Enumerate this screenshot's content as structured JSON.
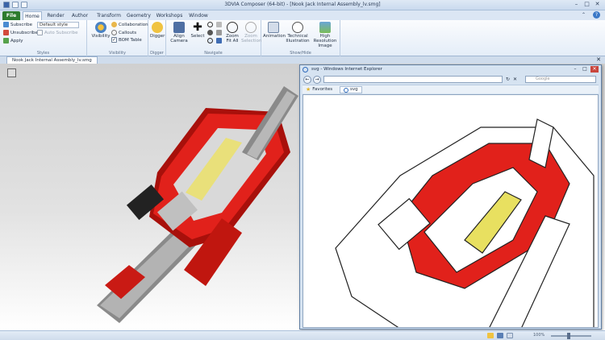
{
  "window": {
    "title": "3DVIA Composer (64-bit) - [Nook Jack Internal Assembly_lv.smg]"
  },
  "tabs": [
    "File",
    "Home",
    "Render",
    "Author",
    "Transform",
    "Geometry",
    "Workshops",
    "Window"
  ],
  "ribbon": {
    "styles": {
      "subscribe": "Subscribe",
      "unsubscribe": "Unsubscribe",
      "apply": "Apply",
      "style_value": "Default style",
      "auto_subscribe": "Auto Subscribe",
      "label": "Styles"
    },
    "visibility": {
      "visibility": "Visibility",
      "collaboration": "Collaboration",
      "callouts": "Callouts",
      "bom_table": "BOM Table",
      "label": "Visibility"
    },
    "digger": {
      "digger": "Digger",
      "label": "Digger"
    },
    "navigate": {
      "align_camera": "Align Camera",
      "select": "Select",
      "zoom_fit_all": "Zoom Fit All",
      "zoom_selection": "Zoom Selection",
      "label": "Navigate"
    },
    "showhide": {
      "animation": "Animation",
      "technical_illustration": "Technical Illustration",
      "high_resolution_image": "High Resolution Image",
      "label": "Show/Hide"
    }
  },
  "document_tab": "Nook Jack Internal Assembly_lv.smg",
  "ie": {
    "title": "svg - Windows Internet Explorer",
    "search_placeholder": "Google",
    "favorites": "Favorites",
    "tab": "svg"
  },
  "statusbar": {
    "zoom": "100%"
  },
  "colors": {
    "accent_red": "#e1211b",
    "shadow_red": "#a8100b",
    "file_tab": "#2d7b2e",
    "ribbon_bg": "#e4edf8"
  }
}
